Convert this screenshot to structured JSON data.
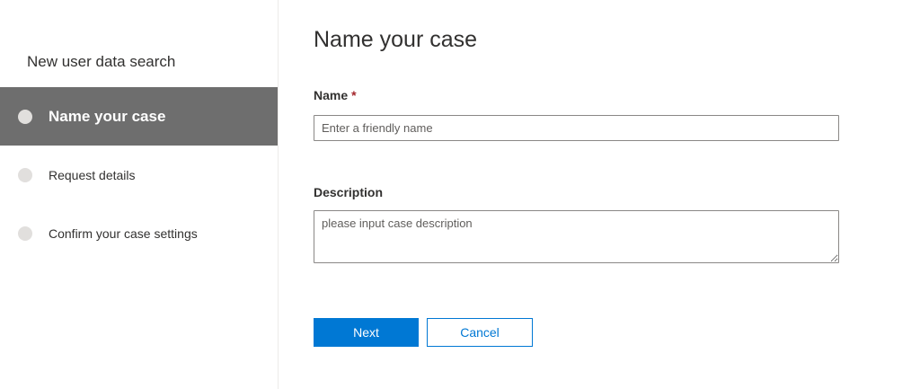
{
  "sidebar": {
    "title": "New user data search",
    "steps": [
      {
        "label": "Name your case",
        "active": true
      },
      {
        "label": "Request details",
        "active": false
      },
      {
        "label": "Confirm your case settings",
        "active": false
      }
    ]
  },
  "main": {
    "title": "Name your case",
    "name_field": {
      "label": "Name",
      "required_marker": "*",
      "placeholder": "Enter a friendly name",
      "value": ""
    },
    "description_field": {
      "label": "Description",
      "placeholder": "please input case description",
      "value": ""
    },
    "buttons": {
      "next_label": "Next",
      "cancel_label": "Cancel"
    }
  },
  "colors": {
    "accent": "#0078d4",
    "active_step_bg": "#6e6e6e",
    "step_dot": "#e1dfdd",
    "required": "#a4262c"
  }
}
